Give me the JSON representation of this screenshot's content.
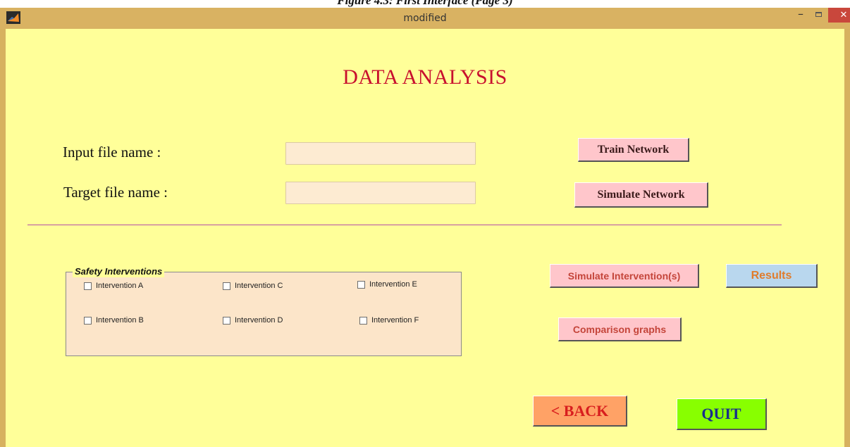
{
  "caption": "Figure 4.3: First Interface (Page 3)",
  "window": {
    "title": "modified",
    "minimize_label": "–",
    "close_label": "✕"
  },
  "heading": "DATA ANALYSIS",
  "inputs": {
    "input_file_label": "Input file name :",
    "input_file_value": "",
    "target_file_label": "Target file name :",
    "target_file_value": ""
  },
  "buttons": {
    "train": "Train Network",
    "simulate": "Simulate Network",
    "simulate_interventions": "Simulate Intervention(s)",
    "results": "Results",
    "comparison": "Comparison graphs",
    "back": "< BACK",
    "quit": "QUIT"
  },
  "safety": {
    "title": "Safety Interventions",
    "items": [
      {
        "label": "Intervention A",
        "checked": false
      },
      {
        "label": "Intervention B",
        "checked": false
      },
      {
        "label": "Intervention C",
        "checked": false
      },
      {
        "label": "Intervention D",
        "checked": false
      },
      {
        "label": "Intervention E",
        "checked": false
      },
      {
        "label": "Intervention F",
        "checked": false
      }
    ]
  },
  "colors": {
    "background": "#ffff99",
    "heading": "#c8102e",
    "button_pink": "#ffc6cb",
    "results_blue": "#b9d7ee",
    "back_orange": "#ffa266",
    "quit_green": "#88ff00"
  }
}
